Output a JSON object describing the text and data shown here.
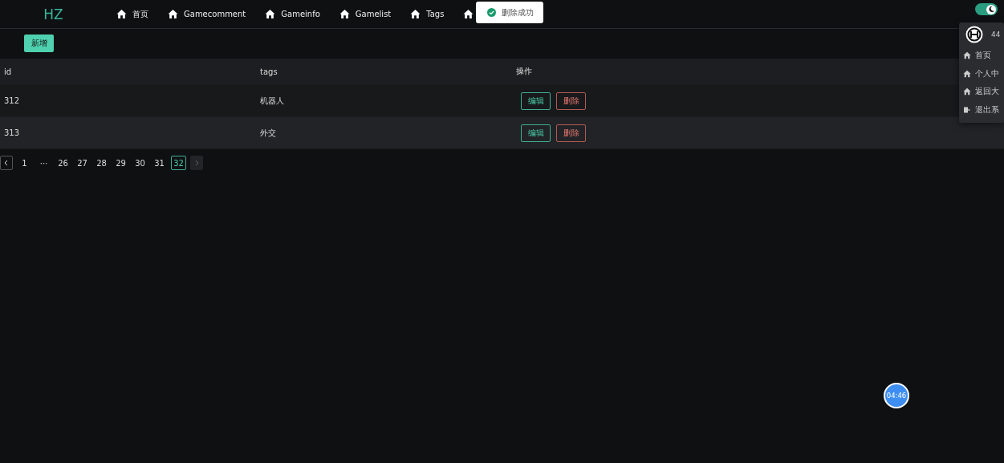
{
  "header": {
    "logo": "HZ",
    "nav": [
      {
        "kind": "link",
        "label": "首页"
      },
      {
        "kind": "link",
        "label": "Gamecomment"
      },
      {
        "kind": "link",
        "label": "Gameinfo"
      },
      {
        "kind": "link",
        "label": "Gamelist"
      },
      {
        "kind": "link",
        "label": "Tags"
      },
      {
        "kind": "icon_only"
      }
    ],
    "theme_toggle": {
      "on": true
    }
  },
  "toast": {
    "message": "删除成功"
  },
  "user_menu": {
    "username": "44",
    "items": [
      {
        "kind": "home",
        "label": "首页"
      },
      {
        "kind": "home",
        "label": "个人中"
      },
      {
        "kind": "home",
        "label": "返回大"
      },
      {
        "kind": "logout",
        "label": "退出系"
      }
    ]
  },
  "add_button": "新增",
  "table": {
    "columns": [
      "id",
      "tags",
      "操作"
    ],
    "rows": [
      {
        "id": "312",
        "tags": "机器人",
        "actions": [
          "编辑",
          "删除"
        ]
      },
      {
        "id": "313",
        "tags": "外交",
        "actions": [
          "编辑",
          "删除"
        ]
      }
    ]
  },
  "pagination": {
    "prev_disabled": false,
    "next_disabled": true,
    "pages": [
      {
        "label": "1",
        "selected": false
      },
      {
        "label": "···",
        "selected": false
      },
      {
        "label": "26",
        "selected": false
      },
      {
        "label": "27",
        "selected": false
      },
      {
        "label": "28",
        "selected": false
      },
      {
        "label": "29",
        "selected": false
      },
      {
        "label": "30",
        "selected": false
      },
      {
        "label": "31",
        "selected": false
      },
      {
        "label": "32",
        "selected": true
      }
    ]
  },
  "timer": "04:46"
}
